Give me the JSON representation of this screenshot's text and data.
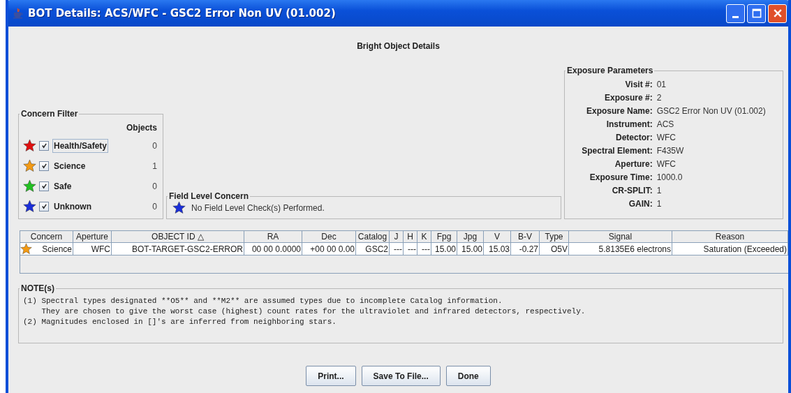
{
  "window": {
    "title": "BOT Details: ACS/WFC - GSC2 Error Non UV (01.002)"
  },
  "heading": "Bright Object Details",
  "concern_filter": {
    "title": "Concern Filter",
    "objects_header": "Objects",
    "items": [
      {
        "label": "Health/Safety",
        "color": "#e01010",
        "checked": true,
        "focused": true,
        "count": "0"
      },
      {
        "label": "Science",
        "color": "#f39a14",
        "checked": true,
        "focused": false,
        "count": "1"
      },
      {
        "label": "Safe",
        "color": "#22c022",
        "checked": true,
        "focused": false,
        "count": "0"
      },
      {
        "label": "Unknown",
        "color": "#1a2ed8",
        "checked": true,
        "focused": false,
        "count": "0"
      }
    ]
  },
  "field_level_concern": {
    "title": "Field Level Concern",
    "color": "#1a2ed8",
    "message": "No Field Level Check(s) Performed."
  },
  "exposure_parameters": {
    "title": "Exposure Parameters",
    "fields": [
      {
        "label": "Visit #:",
        "value": "01"
      },
      {
        "label": "Exposure #:",
        "value": "2"
      },
      {
        "label": "Exposure Name:",
        "value": "GSC2 Error Non UV (01.002)"
      },
      {
        "label": "Instrument:",
        "value": "ACS"
      },
      {
        "label": "Detector:",
        "value": "WFC"
      },
      {
        "label": "Spectral Element:",
        "value": "F435W"
      },
      {
        "label": "Aperture:",
        "value": "WFC"
      },
      {
        "label": "Exposure Time:",
        "value": "1000.0"
      },
      {
        "label": "CR-SPLIT:",
        "value": "1"
      },
      {
        "label": "GAIN:",
        "value": "1"
      }
    ]
  },
  "table": {
    "columns": [
      "Concern",
      "Aperture",
      "OBJECT ID △",
      "RA",
      "Dec",
      "Catalog",
      "J",
      "H",
      "K",
      "Fpg",
      "Jpg",
      "V",
      "B-V",
      "Type",
      "Signal",
      "Reason"
    ],
    "rows": [
      {
        "color": "#f39a14",
        "cells": [
          "Science",
          "WFC",
          "BOT-TARGET-GSC2-ERROR",
          "00 00 0.0000",
          "+00 00 0.00",
          "GSC2",
          "---",
          "---",
          "---",
          "15.00",
          "15.00",
          "15.03",
          "-0.27",
          "O5V",
          "5.8135E6 electrons",
          "Saturation (Exceeded)"
        ]
      }
    ]
  },
  "notes": {
    "title": "NOTE(s)",
    "lines": [
      "(1) Spectral types designated **O5** and **M2** are assumed types due to incomplete Catalog information.",
      "    They are chosen to give the worst case (highest) count rates for the ultraviolet and infrared detectors, respectively.",
      "(2) Magnitudes enclosed in []'s are inferred from neighboring stars."
    ]
  },
  "buttons": [
    "Print...",
    "Save To File...",
    "Done"
  ]
}
